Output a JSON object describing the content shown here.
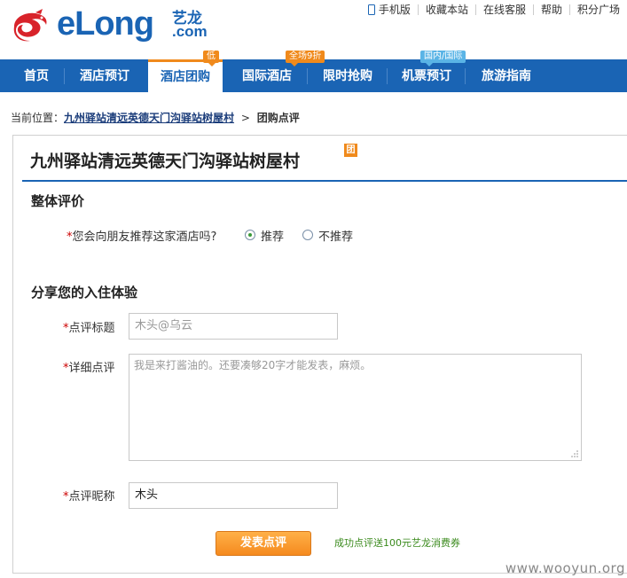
{
  "brand": {
    "logo_text": "eLong",
    "logo_cn": "艺龙",
    "logo_com": ".com"
  },
  "toplinks": [
    "手机版",
    "收藏本站",
    "在线客服",
    "帮助",
    "积分广场"
  ],
  "nav": {
    "items": [
      "首页",
      "酒店预订",
      "酒店团购",
      "国际酒店",
      "限时抢购",
      "机票预订",
      "旅游指南"
    ],
    "badges": {
      "group": "低",
      "intl": "全场9折",
      "flight": "国内/国际"
    }
  },
  "breadcrumb": {
    "prefix": "当前位置：",
    "link": "九州驿站清远英德天门沟驿站树屋村",
    "sep": ">",
    "current": "团购点评"
  },
  "hotel": {
    "name": "九州驿站清远英德天门沟驿站树屋村",
    "tag": "团"
  },
  "overall": {
    "title": "整体评价",
    "question": "您会向朋友推荐这家酒店吗?",
    "options": [
      "推荐",
      "不推荐"
    ],
    "selected": "推荐"
  },
  "share": {
    "title": "分享您的入住体验",
    "title_label": "点评标题",
    "title_placeholder": "木头@乌云",
    "detail_label": "详细点评",
    "detail_placeholder": "我是来打酱油的。还要凑够20字才能发表，麻烦。",
    "nick_label": "点评昵称",
    "nick_value": "木头"
  },
  "submit": {
    "label": "发表点评",
    "promo": "成功点评送100元艺龙消费券"
  },
  "watermark": "www.wooyun.org",
  "colors": {
    "brand_blue": "#1a64b4",
    "accent_orange": "#f08a1c",
    "promo_green": "#3a8a1c",
    "required_red": "#cc0000"
  }
}
